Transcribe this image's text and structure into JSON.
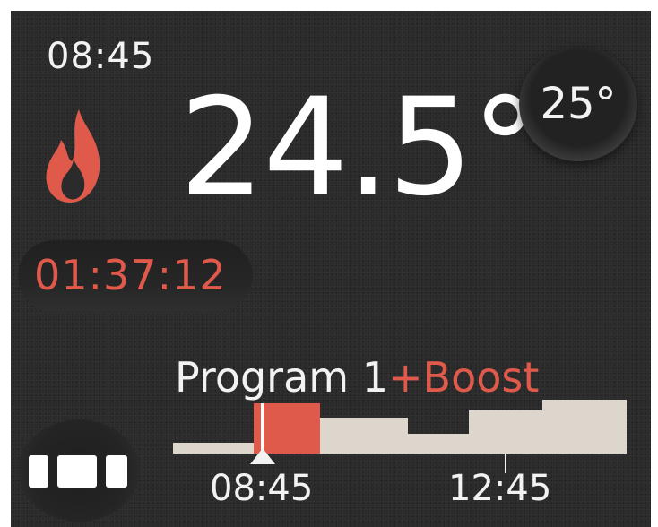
{
  "status": {
    "clock": "08:45",
    "current_temperature": "24.5°",
    "setpoint_temperature": "25°",
    "boost_timer": "01:37:12",
    "heating_icon": "flame-icon"
  },
  "program": {
    "name": "Program 1",
    "boost_suffix": "+Boost",
    "current_time_label": "08:45",
    "marker_time_label": "12:45"
  },
  "colors": {
    "background": "#2b2b2b",
    "accent_red": "#e05a4c",
    "schedule_block": "#dcd6cc",
    "text": "#f2f2f2"
  },
  "menu": {
    "icon": "menu-bars-icon"
  }
}
